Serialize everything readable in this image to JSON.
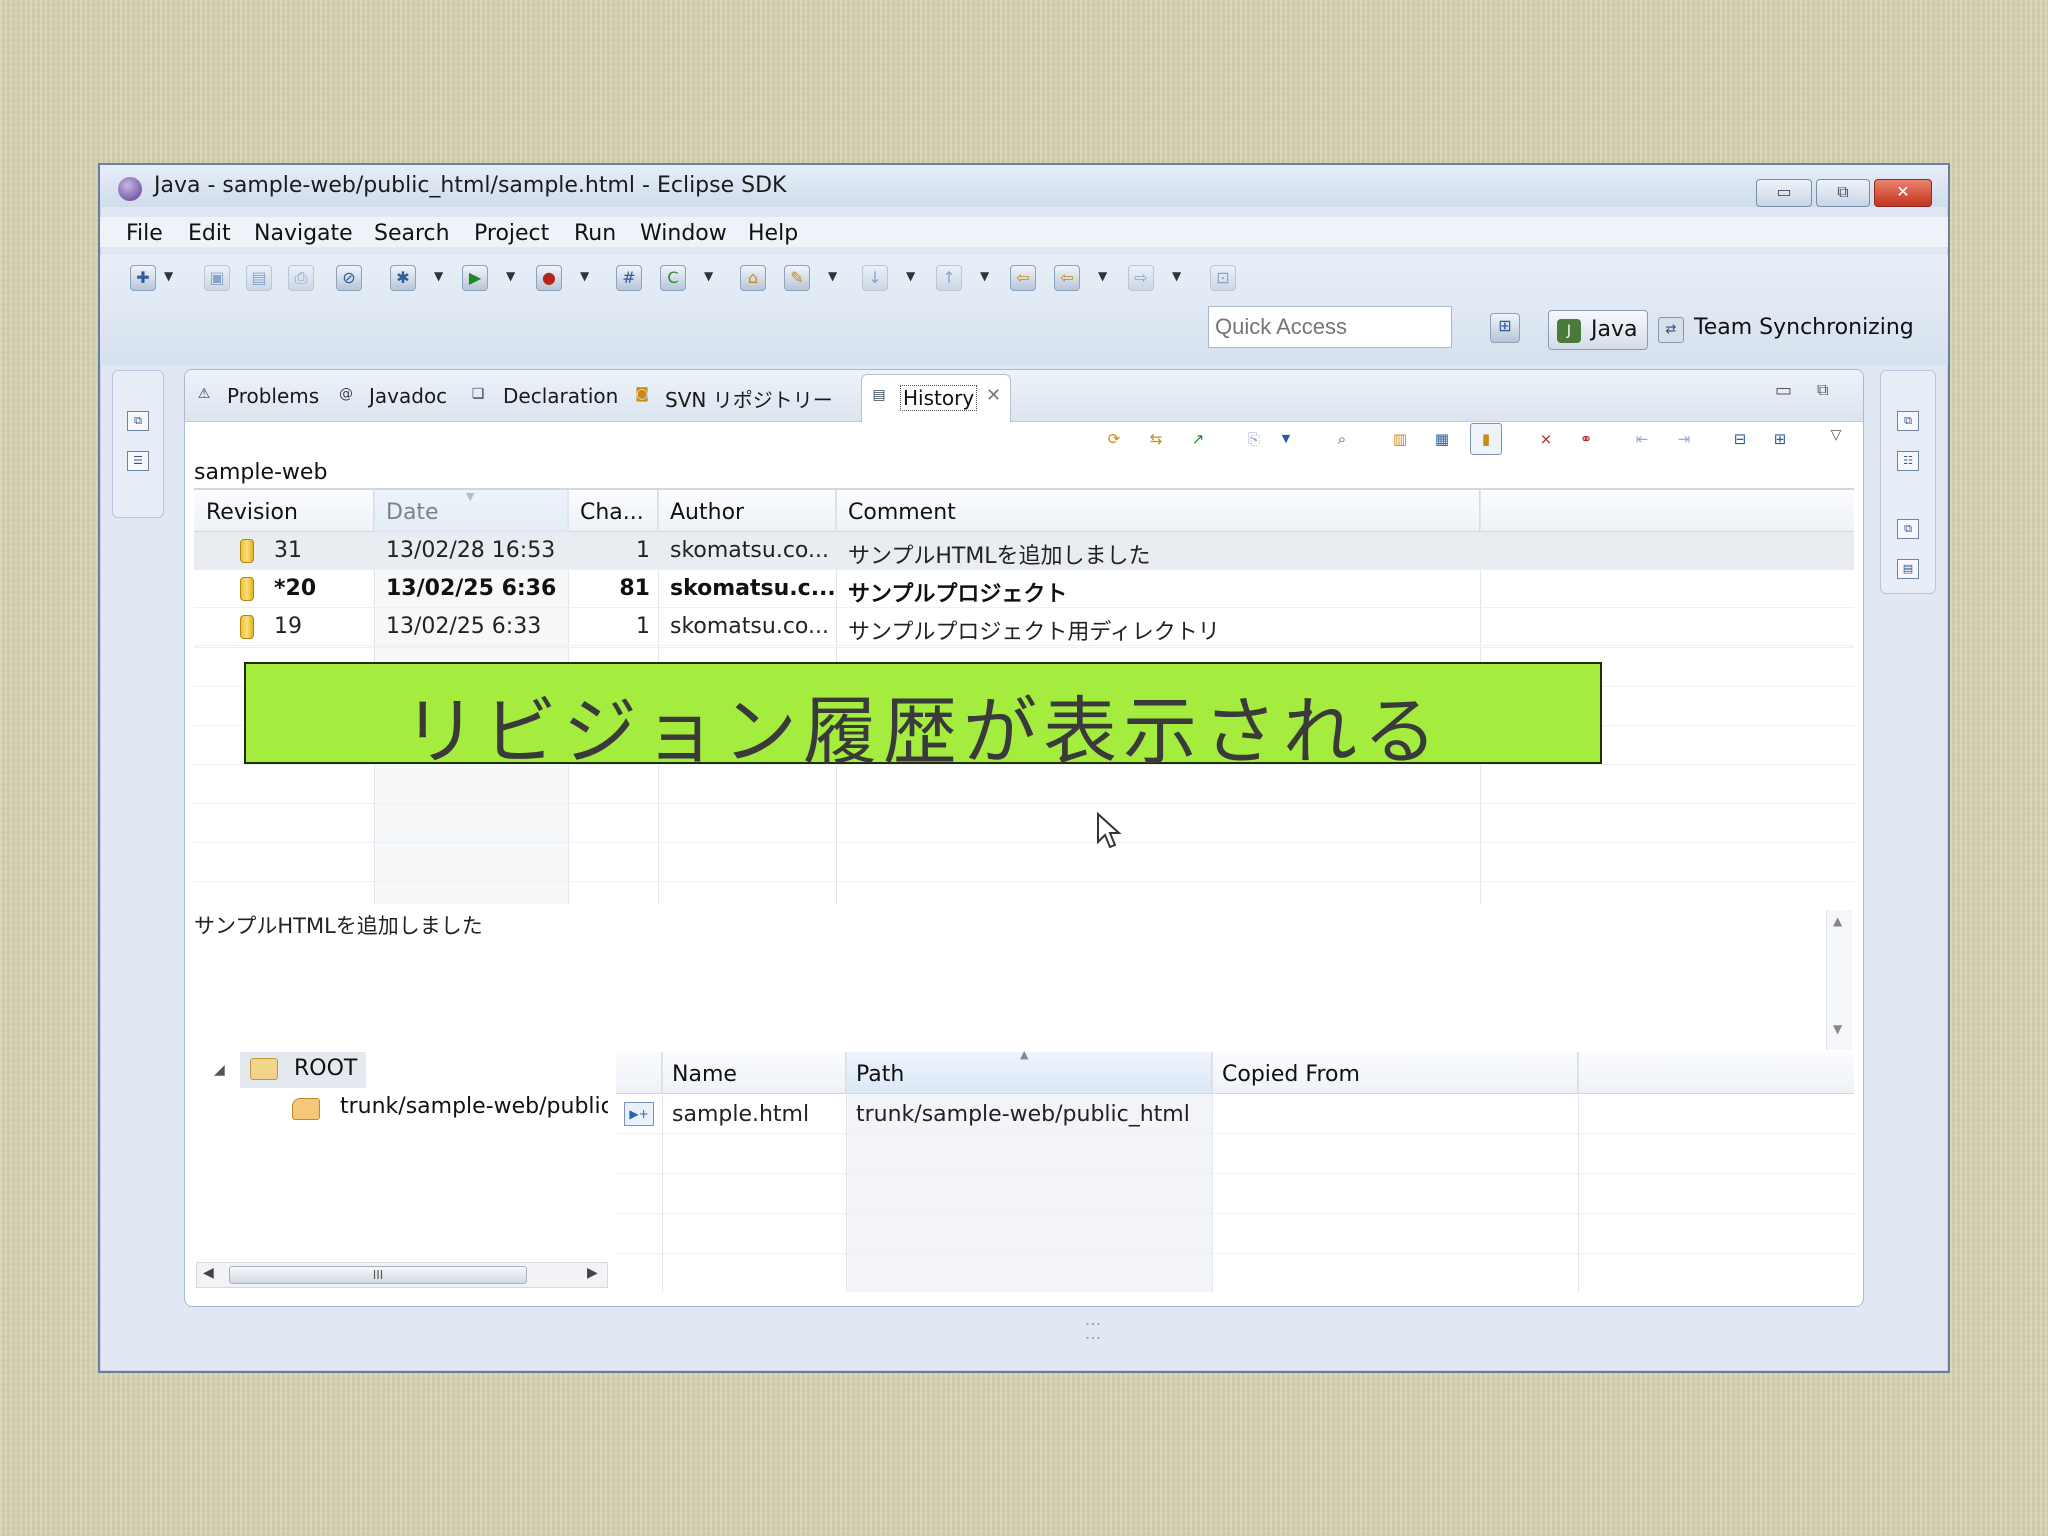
{
  "window": {
    "title": "Java - sample-web/public_html/sample.html - Eclipse SDK",
    "controls": {
      "minimize": "▭",
      "maximize": "⧉",
      "close": "✕"
    }
  },
  "menu": [
    "File",
    "Edit",
    "Navigate",
    "Search",
    "Project",
    "Run",
    "Window",
    "Help"
  ],
  "quick_access": {
    "placeholder": "Quick Access"
  },
  "perspectives": {
    "java": "Java",
    "team": "Team Synchronizing"
  },
  "view_tabs": {
    "problems": "Problems",
    "javadoc": "Javadoc",
    "declaration": "Declaration",
    "svn": "SVN リポジトリー",
    "history": "History"
  },
  "history": {
    "resource": "sample-web",
    "columns": [
      "Revision",
      "Date",
      "Cha...",
      "Author",
      "Comment"
    ],
    "rows": [
      {
        "revision": "31",
        "date": "13/02/28 16:53",
        "changes": "1",
        "author": "skomatsu.co...",
        "comment": "サンプルHTMLを追加しました",
        "bold": false
      },
      {
        "revision": "*20",
        "date": "13/02/25 6:36",
        "changes": "81",
        "author": "skomatsu.c...",
        "comment": "サンプルプロジェクト",
        "bold": true
      },
      {
        "revision": "19",
        "date": "13/02/25 6:33",
        "changes": "1",
        "author": "skomatsu.co...",
        "comment": "サンプルプロジェクト用ディレクトリ",
        "bold": false
      }
    ],
    "comment_text": "サンプルHTMLを追加しました"
  },
  "banner": {
    "text": "リビジョン履歴が表示される",
    "color": "#a4ec3e"
  },
  "tree": {
    "root": "ROOT",
    "child": "trunk/sample-web/public_html"
  },
  "paths": {
    "columns": [
      "Name",
      "Path",
      "Copied From"
    ],
    "rows": [
      {
        "name": "sample.html",
        "path": "trunk/sample-web/public_html",
        "copied_from": ""
      }
    ]
  },
  "scrollbar": {
    "thumb_label": "III"
  }
}
